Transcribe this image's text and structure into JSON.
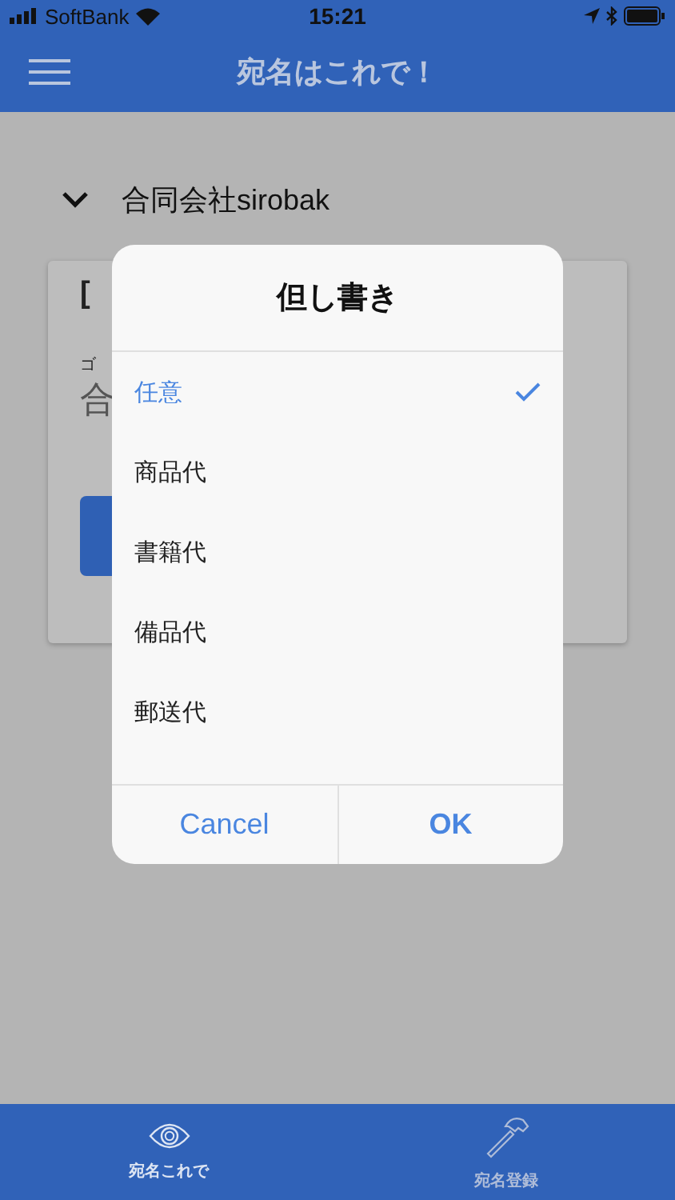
{
  "status_bar": {
    "carrier": "SoftBank",
    "time": "15:21"
  },
  "header": {
    "title": "宛名はこれで！"
  },
  "accordion": {
    "title": "合同会社sirobak",
    "expanded": true
  },
  "card": {
    "heading": "[",
    "kana": "ゴ",
    "name": "合"
  },
  "dialog": {
    "title": "但し書き",
    "items": [
      {
        "label": "任意",
        "selected": true
      },
      {
        "label": "商品代",
        "selected": false
      },
      {
        "label": "書籍代",
        "selected": false
      },
      {
        "label": "備品代",
        "selected": false
      },
      {
        "label": "郵送代",
        "selected": false
      }
    ],
    "buttons": [
      {
        "label": "Cancel",
        "kind": "cancel"
      },
      {
        "label": "OK",
        "kind": "ok"
      }
    ]
  },
  "tabs": [
    {
      "label": "宛名これで",
      "kind": "eye",
      "selected": true
    },
    {
      "label": "宛名登録",
      "kind": "hammer",
      "selected": false
    }
  ]
}
